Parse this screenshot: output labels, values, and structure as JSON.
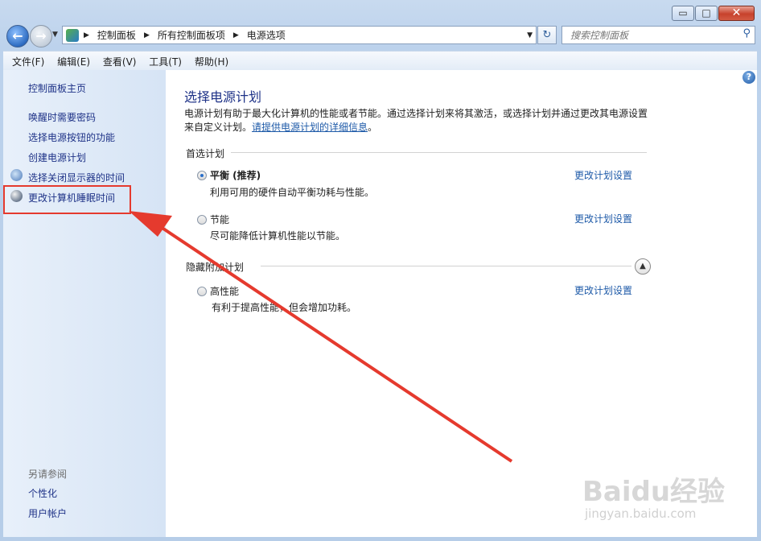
{
  "window": {
    "caption_buttons": {
      "minimize": "▭",
      "maximize": "□",
      "close": "✕"
    }
  },
  "nav": {
    "breadcrumbs": [
      "控制面板",
      "所有控制面板项",
      "电源选项"
    ],
    "search_placeholder": "搜索控制面板"
  },
  "menu": [
    "文件(F)",
    "编辑(E)",
    "查看(V)",
    "工具(T)",
    "帮助(H)"
  ],
  "sidebar": {
    "home": "控制面板主页",
    "links": [
      "唤醒时需要密码",
      "选择电源按钮的功能",
      "创建电源计划",
      "选择关闭显示器的时间",
      "更改计算机睡眠时间"
    ],
    "see_also_title": "另请参阅",
    "see_also": [
      "个性化",
      "用户帐户"
    ]
  },
  "main": {
    "title": "选择电源计划",
    "desc_line1": "电源计划有助于最大化计算机的性能或者节能。通过选择计划来将其激活，或选择计划并通过更改其电源设置",
    "desc_line2": "来自定义计划。",
    "desc_link": "请提供电源计划的详细信息",
    "desc_end": "。",
    "preferred_label": "首选计划",
    "hidden_label": "隐藏附加计划",
    "plans": [
      {
        "name": "平衡 (推荐)",
        "desc": "利用可用的硬件自动平衡功耗与性能。",
        "link": "更改计划设置",
        "selected": true
      },
      {
        "name": "节能",
        "desc": "尽可能降低计算机性能以节能。",
        "link": "更改计划设置",
        "selected": false
      },
      {
        "name": "高性能",
        "desc": "有利于提高性能，但会增加功耗。",
        "link": "更改计划设置",
        "selected": false
      }
    ]
  },
  "annotation_color": "#e53a2e",
  "watermark": {
    "brand": "Baidu经验",
    "url": "jingyan.baidu.com"
  }
}
